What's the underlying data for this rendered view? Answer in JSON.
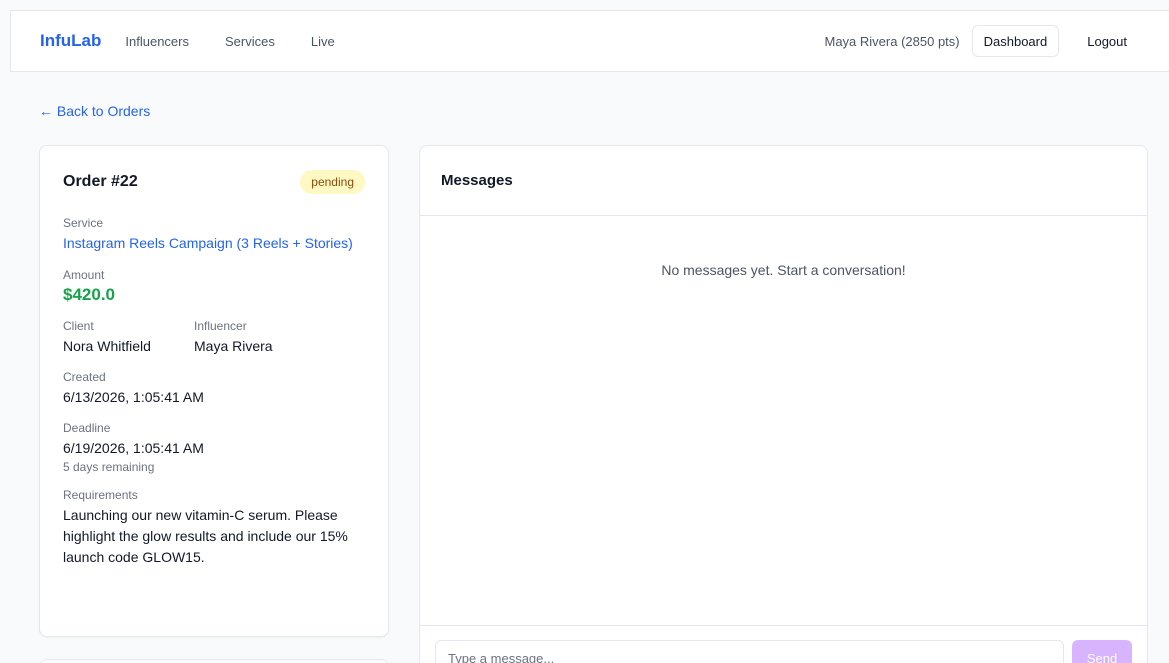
{
  "nav": {
    "brand": "InfuLab",
    "links": [
      "Influencers",
      "Services",
      "Live"
    ],
    "user": "Maya Rivera (2850 pts)",
    "dashboard_label": "Dashboard",
    "logout_label": "Logout"
  },
  "back_link": "← Back to Orders",
  "order": {
    "title": "Order #22",
    "status": "pending",
    "service_label": "Service",
    "service_value": "Instagram Reels Campaign (3 Reels + Stories)",
    "amount_label": "Amount",
    "amount_value": "$420.0",
    "client_label": "Client",
    "client_value": "Nora Whitfield",
    "influencer_label": "Influencer",
    "influencer_value": "Maya Rivera",
    "created_label": "Created",
    "created_value": "6/13/2026, 1:05:41 AM",
    "deadline_label": "Deadline",
    "deadline_value": "6/19/2026, 1:05:41 AM",
    "deadline_note": "5 days remaining",
    "requirements_label": "Requirements",
    "requirements_value": "Launching our new vitamin-C serum. Please highlight the glow results and include our 15% launch code GLOW15."
  },
  "messages": {
    "title": "Messages",
    "empty_text": "No messages yet. Start a conversation!",
    "input_placeholder": "Type a message...",
    "send_label": "Send"
  },
  "colors": {
    "accent": "#2563eb",
    "amount": "#16a34a",
    "badge_bg": "#fef9c3",
    "send_disabled": "#d8b4fe"
  }
}
